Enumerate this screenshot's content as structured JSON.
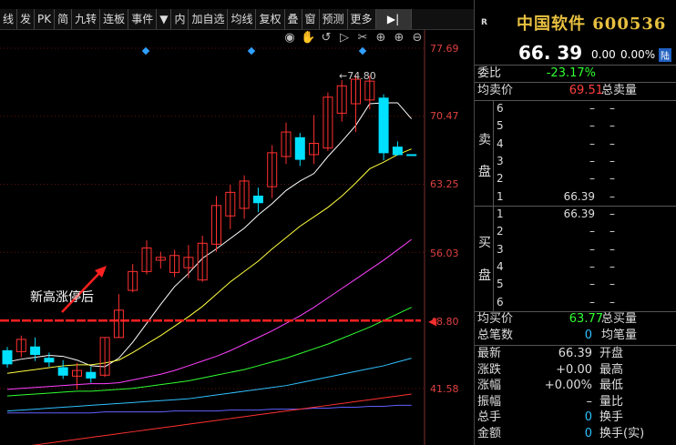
{
  "toolbar": {
    "items": [
      "线",
      "发",
      "PK",
      "简",
      "九转",
      "连板",
      "事件",
      "▼",
      "内",
      "加自选",
      "均线",
      "复权",
      "叠",
      "窗",
      "预测",
      "更多",
      "▶|"
    ]
  },
  "chart": {
    "price_labels": [
      "77.69",
      "70.47",
      "63.25",
      "56.03",
      "48.80",
      "41.58"
    ],
    "annotation": "新高涨停后",
    "marker_arrow": "◀",
    "icons": [
      "eye-icon",
      "hand-icon",
      "refresh-icon",
      "play-icon",
      "scissors-icon",
      "target-icon",
      "zoom-in-icon",
      "zoom-out-icon"
    ],
    "icon_glyphs": [
      "◉",
      "✋",
      "↺",
      "▷",
      "✂",
      "⊕",
      "⊕",
      "⊖"
    ],
    "peak_label": "74.80",
    "colors": {
      "up": "#ff3030",
      "down": "#00e0ff",
      "ma5": "#ffffff",
      "ma10": "#ffff40",
      "ma20": "#ff40ff",
      "ma30": "#30ff30",
      "ma60": "#30a0ff"
    }
  },
  "chart_data": {
    "type": "candlestick",
    "y_range": [
      41.58,
      77.69
    ],
    "candles": [
      {
        "o": 44.2,
        "c": 45.6,
        "h": 46.0,
        "l": 43.8,
        "up": false
      },
      {
        "o": 45.5,
        "c": 46.8,
        "h": 47.2,
        "l": 44.9,
        "up": true
      },
      {
        "o": 46.0,
        "c": 45.2,
        "h": 47.0,
        "l": 44.5,
        "up": false
      },
      {
        "o": 44.8,
        "c": 44.4,
        "h": 45.4,
        "l": 43.9,
        "up": false
      },
      {
        "o": 43.8,
        "c": 43.0,
        "h": 44.6,
        "l": 42.6,
        "up": false
      },
      {
        "o": 42.9,
        "c": 43.5,
        "h": 44.3,
        "l": 41.5,
        "up": true
      },
      {
        "o": 43.3,
        "c": 42.7,
        "h": 43.9,
        "l": 42.2,
        "up": false
      },
      {
        "o": 43.0,
        "c": 47.0,
        "h": 47.0,
        "l": 42.8,
        "up": true
      },
      {
        "o": 47.0,
        "c": 49.9,
        "h": 51.6,
        "l": 47.0,
        "up": true
      },
      {
        "o": 52.0,
        "c": 54.0,
        "h": 54.8,
        "l": 51.8,
        "up": true
      },
      {
        "o": 54.0,
        "c": 56.5,
        "h": 57.3,
        "l": 53.7,
        "up": true
      },
      {
        "o": 55.2,
        "c": 55.5,
        "h": 56.1,
        "l": 54.3,
        "up": true
      },
      {
        "o": 53.9,
        "c": 55.7,
        "h": 56.3,
        "l": 53.4,
        "up": true
      },
      {
        "o": 54.4,
        "c": 55.5,
        "h": 56.8,
        "l": 53.3,
        "up": true
      },
      {
        "o": 53.1,
        "c": 57.0,
        "h": 57.8,
        "l": 52.9,
        "up": true
      },
      {
        "o": 56.9,
        "c": 61.0,
        "h": 62.0,
        "l": 56.1,
        "up": true
      },
      {
        "o": 59.9,
        "c": 62.4,
        "h": 63.2,
        "l": 58.5,
        "up": true
      },
      {
        "o": 60.7,
        "c": 63.6,
        "h": 64.2,
        "l": 59.6,
        "up": true
      },
      {
        "o": 62.0,
        "c": 61.3,
        "h": 62.9,
        "l": 60.3,
        "up": false
      },
      {
        "o": 63.0,
        "c": 66.6,
        "h": 67.4,
        "l": 61.8,
        "up": true
      },
      {
        "o": 66.2,
        "c": 68.8,
        "h": 69.8,
        "l": 65.4,
        "up": true
      },
      {
        "o": 68.2,
        "c": 65.9,
        "h": 68.7,
        "l": 65.2,
        "up": false
      },
      {
        "o": 66.4,
        "c": 67.6,
        "h": 70.6,
        "l": 65.4,
        "up": true
      },
      {
        "o": 67.1,
        "c": 72.5,
        "h": 73.0,
        "l": 66.8,
        "up": true
      },
      {
        "o": 70.8,
        "c": 73.7,
        "h": 74.3,
        "l": 69.9,
        "up": true
      },
      {
        "o": 71.8,
        "c": 74.4,
        "h": 74.8,
        "l": 68.8,
        "up": true
      },
      {
        "o": 72.2,
        "c": 74.2,
        "h": 74.8,
        "l": 71.2,
        "up": true
      },
      {
        "o": 72.4,
        "c": 66.6,
        "h": 72.8,
        "l": 65.8,
        "up": false
      },
      {
        "o": 67.2,
        "c": 66.4,
        "h": 67.8,
        "l": 66.3,
        "up": false
      },
      {
        "o": 66.4,
        "c": 66.4,
        "h": 66.4,
        "l": 66.4,
        "up": false
      }
    ],
    "ma_lines": [
      {
        "name": "ma5",
        "color": "#ffffff",
        "values": [
          44.4,
          44.7,
          44.9,
          45.1,
          45.0,
          44.6,
          44.0,
          43.9,
          44.8,
          46.5,
          48.5,
          50.5,
          52.4,
          53.8,
          55.4,
          56.4,
          57.5,
          58.6,
          60.0,
          61.2,
          62.6,
          63.6,
          64.4,
          66.2,
          67.8,
          69.5,
          71.8,
          71.9,
          71.9,
          70.2
        ]
      },
      {
        "name": "ma10",
        "color": "#ffff40",
        "values": [
          43.2,
          43.4,
          43.6,
          43.8,
          44.0,
          44.1,
          44.1,
          44.3,
          44.6,
          45.4,
          46.3,
          47.2,
          48.2,
          49.2,
          50.3,
          51.6,
          52.9,
          54.0,
          55.1,
          56.4,
          57.6,
          58.8,
          59.8,
          60.8,
          62.0,
          63.4,
          64.9,
          65.6,
          66.4,
          67.0
        ]
      },
      {
        "name": "ma20",
        "color": "#ff40ff",
        "values": [
          41.5,
          41.6,
          41.7,
          41.8,
          41.9,
          42.0,
          42.1,
          42.1,
          42.2,
          42.5,
          42.8,
          43.1,
          43.5,
          44.0,
          44.5,
          45.0,
          45.6,
          46.3,
          47.0,
          47.7,
          48.5,
          49.3,
          50.2,
          51.2,
          52.2,
          53.2,
          54.2,
          55.2,
          56.3,
          57.4
        ]
      },
      {
        "name": "ma30",
        "color": "#30ff30",
        "values": [
          40.8,
          40.9,
          41.0,
          41.1,
          41.2,
          41.3,
          41.3,
          41.4,
          41.5,
          41.6,
          41.8,
          42.0,
          42.2,
          42.4,
          42.7,
          43.0,
          43.3,
          43.6,
          44.0,
          44.4,
          44.8,
          45.3,
          45.8,
          46.3,
          46.9,
          47.5,
          48.1,
          48.8,
          49.5,
          50.2
        ]
      },
      {
        "name": "ma60",
        "color": "#30c0ff",
        "values": [
          39.2,
          39.3,
          39.4,
          39.5,
          39.6,
          39.7,
          39.8,
          39.9,
          40.0,
          40.1,
          40.2,
          40.3,
          40.4,
          40.5,
          40.7,
          40.9,
          41.1,
          41.3,
          41.5,
          41.7,
          41.9,
          42.2,
          42.5,
          42.8,
          43.1,
          43.4,
          43.7,
          44.0,
          44.4,
          44.8
        ]
      },
      {
        "name": "ma120",
        "color": "#6060ff",
        "values": [
          39.0,
          39.0,
          39.0,
          39.0,
          39.0,
          39.0,
          39.0,
          39.1,
          39.1,
          39.1,
          39.1,
          39.1,
          39.2,
          39.2,
          39.2,
          39.2,
          39.3,
          39.3,
          39.3,
          39.4,
          39.4,
          39.4,
          39.5,
          39.5,
          39.6,
          39.6,
          39.7,
          39.7,
          39.8,
          39.8
        ]
      },
      {
        "name": "ma250",
        "color": "#ff3030",
        "values": [
          35.2,
          35.4,
          35.6,
          35.8,
          36.0,
          36.2,
          36.4,
          36.6,
          36.8,
          37.0,
          37.2,
          37.4,
          37.6,
          37.8,
          38.0,
          38.2,
          38.4,
          38.6,
          38.8,
          39.0,
          39.2,
          39.4,
          39.6,
          39.8,
          40.0,
          40.2,
          40.4,
          40.6,
          40.8,
          41.0
        ]
      }
    ],
    "horizontal_line": 48.8
  },
  "panel": {
    "badge": "R",
    "name": "中国软件 600536",
    "price": "66. 39",
    "change": "0.00",
    "pct": "0.00%",
    "lu": "陆",
    "weibi_label": "委比",
    "weibi_val": "-23.17%",
    "jmj_label": "均卖价",
    "jmj_val": "69.51",
    "zml_label": "总卖量",
    "sell_side": [
      "卖",
      "盘"
    ],
    "sell_levels": [
      {
        "lvl": "6",
        "price": "–",
        "vol": "–"
      },
      {
        "lvl": "5",
        "price": "–",
        "vol": "–"
      },
      {
        "lvl": "4",
        "price": "–",
        "vol": "–"
      },
      {
        "lvl": "3",
        "price": "–",
        "vol": "–"
      },
      {
        "lvl": "2",
        "price": "–",
        "vol": "–"
      },
      {
        "lvl": "1",
        "price": "66.39",
        "vol": "–"
      }
    ],
    "buy_side": [
      "买",
      "盘"
    ],
    "buy_levels": [
      {
        "lvl": "1",
        "price": "66.39",
        "vol": "–"
      },
      {
        "lvl": "2",
        "price": "–",
        "vol": "–"
      },
      {
        "lvl": "3",
        "price": "–",
        "vol": "–"
      },
      {
        "lvl": "4",
        "price": "–",
        "vol": "–"
      },
      {
        "lvl": "5",
        "price": "–",
        "vol": "–"
      },
      {
        "lvl": "6",
        "price": "–",
        "vol": "–"
      }
    ],
    "jmjia_label": "均买价",
    "jmjia_val": "63.77",
    "zmlb_label": "总买量",
    "zbs_label": "总笔数",
    "zbs_val": "0",
    "jbl_label": "均笔量",
    "stats": [
      {
        "l": "最新",
        "v": "66.39",
        "r": "开盘",
        "vc": "#ddd"
      },
      {
        "l": "涨跌",
        "v": "+0.00",
        "r": "最高",
        "vc": "#ddd"
      },
      {
        "l": "涨幅",
        "v": "+0.00%",
        "r": "最低",
        "vc": "#ddd"
      },
      {
        "l": "振幅",
        "v": "–",
        "r": "量比",
        "vc": "#ddd"
      },
      {
        "l": "总手",
        "v": "0",
        "r": "换手",
        "vc": "#30c0ff"
      },
      {
        "l": "金额",
        "v": "0",
        "r": "换手(实)",
        "vc": "#30c0ff"
      }
    ]
  }
}
